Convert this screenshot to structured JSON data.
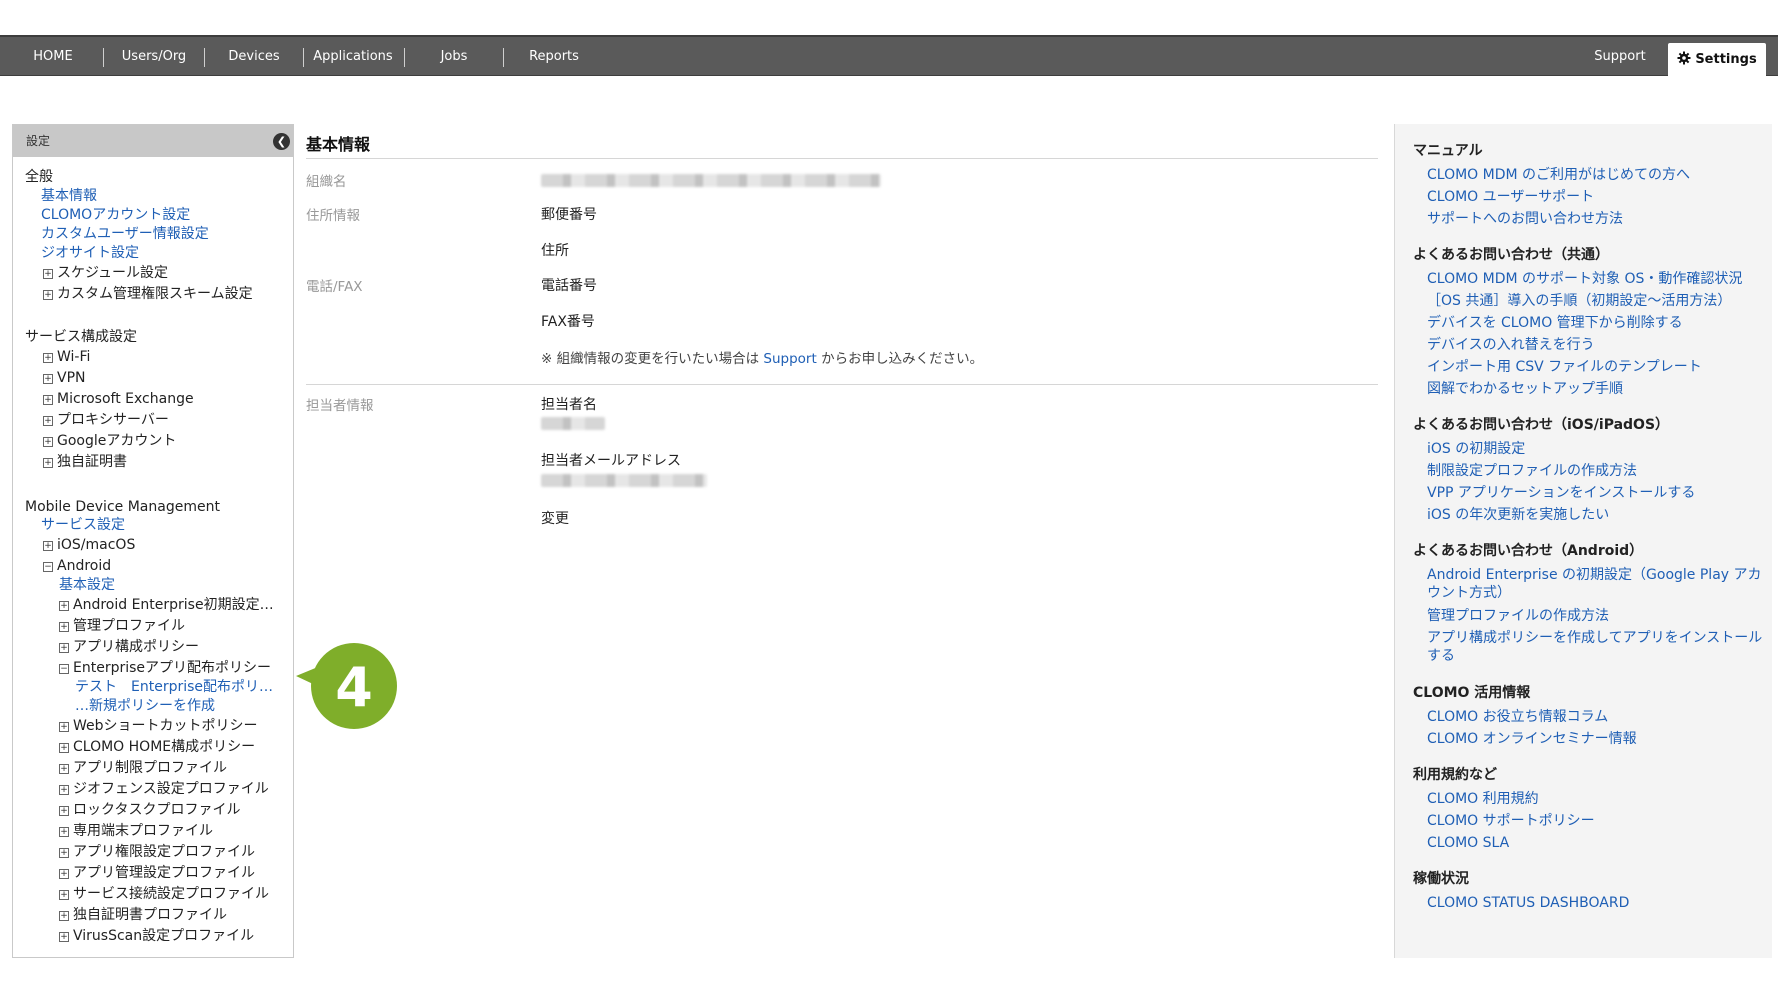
{
  "topnav": {
    "items": [
      "HOME",
      "Users/Org",
      "Devices",
      "Applications",
      "Jobs",
      "Reports"
    ],
    "support": "Support",
    "settings": "Settings"
  },
  "sidebar": {
    "header": "設定",
    "collapse_icon": "chevron-left-icon",
    "sections": {
      "general": {
        "title": "全般",
        "items": [
          "基本情報",
          "CLOMOアカウント設定",
          "カスタムユーザー情報設定",
          "ジオサイト設定",
          "スケジュール設定",
          "カスタム管理権限スキーム設定"
        ]
      },
      "service": {
        "title": "サービス構成設定",
        "items": [
          "Wi-Fi",
          "VPN",
          "Microsoft Exchange",
          "プロキシサーバー",
          "Googleアカウント",
          "独自証明書"
        ]
      },
      "mdm": {
        "title": "Mobile Device Management",
        "service_settings": "サービス設定",
        "ios": "iOS/macOS",
        "android": "Android",
        "android_items": [
          "基本設定",
          "Android Enterprise初期設定…",
          "管理プロファイル",
          "アプリ構成ポリシー",
          "Enterpriseアプリ配布ポリシー",
          "テスト　Enterprise配布ポリ…",
          "…新規ポリシーを作成",
          "Webショートカットポリシー",
          "CLOMO HOME構成ポリシー",
          "アプリ制限プロファイル",
          "ジオフェンス設定プロファイル",
          "ロックタスクプロファイル",
          "専用端末プロファイル",
          "アプリ権限設定プロファイル",
          "アプリ管理設定プロファイル",
          "サービス接続設定プロファイル",
          "独自証明書プロファイル",
          "VirusScan設定プロファイル"
        ]
      }
    }
  },
  "main": {
    "title": "基本情報",
    "org_label": "組織名",
    "address_label": "住所情報",
    "postal": "郵便番号",
    "address": "住所",
    "phone_label": "電話/FAX",
    "phone": "電話番号",
    "fax": "FAX番号",
    "note_prefix": "※ 組織情報の変更を行いたい場合は",
    "note_link": "Support",
    "note_suffix": "からお申し込みください。",
    "contact_label": "担当者情報",
    "contact_name": "担当者名",
    "contact_email": "担当者メールアドレス",
    "change": "変更"
  },
  "rightpanel": {
    "manual_title": "マニュアル",
    "manual": [
      "CLOMO MDM のご利用がはじめての方へ",
      "CLOMO ユーザーサポート",
      "サポートへのお問い合わせ方法"
    ],
    "faq_common_title": "よくあるお問い合わせ（共通）",
    "faq_common": [
      "CLOMO MDM のサポート対象 OS・動作確認状況",
      "［OS 共通］導入の手順（初期設定〜活用方法）",
      "デバイスを CLOMO 管理下から削除する",
      "デバイスの入れ替えを行う",
      "インポート用 CSV ファイルのテンプレート",
      "図解でわかるセットアップ手順"
    ],
    "faq_ios_title": "よくあるお問い合わせ（iOS/iPadOS）",
    "faq_ios": [
      "iOS の初期設定",
      "制限設定プロファイルの作成方法",
      "VPP アプリケーションをインストールする",
      "iOS の年次更新を実施したい"
    ],
    "faq_android_title": "よくあるお問い合わせ（Android）",
    "faq_android": [
      "Android Enterprise の初期設定（Google Play アカウント方式）",
      "管理プロファイルの作成方法",
      "アプリ構成ポリシーを作成してアプリをインストールする"
    ],
    "info_title": "CLOMO 活用情報",
    "info": [
      "CLOMO お役立ち情報コラム",
      "CLOMO オンラインセミナー情報"
    ],
    "terms_title": "利用規約など",
    "terms": [
      "CLOMO 利用規約",
      "CLOMO サポートポリシー",
      "CLOMO SLA"
    ],
    "status_title": "稼働状況",
    "status": [
      "CLOMO STATUS DASHBOARD"
    ]
  },
  "callout": {
    "number": "4",
    "color": "#7fae2a"
  }
}
